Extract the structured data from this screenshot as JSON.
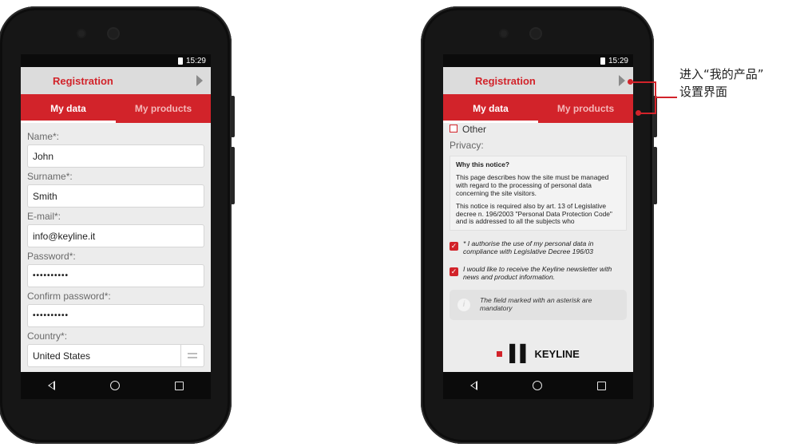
{
  "annotation": {
    "line1": "进入“我的产品”",
    "line2": "设置界面",
    "color": "#d2232a"
  },
  "theme": {
    "accent": "#d2232a",
    "appbar_bg": "#dcdcdc",
    "screen_bg": "#ececec"
  },
  "left_phone": {
    "status_time": "15:29",
    "header_title": "Registration",
    "tabs": [
      {
        "label": "My data",
        "active": true
      },
      {
        "label": "My products",
        "active": false
      }
    ],
    "fields": [
      {
        "label": "Name*:",
        "value": "John"
      },
      {
        "label": "Surname*:",
        "value": "Smith"
      },
      {
        "label": "E-mail*:",
        "value": "info@keyline.it"
      },
      {
        "label": "Password*:",
        "value": "••••••••••"
      },
      {
        "label": "Confirm password*:",
        "value": "••••••••••"
      },
      {
        "label": "Country*:",
        "value": "United States"
      }
    ]
  },
  "right_phone": {
    "status_time": "15:29",
    "header_title": "Registration",
    "tabs": [
      {
        "label": "My data",
        "active": true
      },
      {
        "label": "My products",
        "active": false
      }
    ],
    "other_option": "Other",
    "privacy_label": "Privacy:",
    "privacy_heading": "Why this notice?",
    "privacy_p1": "This page describes how the site must be managed with regard to the processing of personal data concerning the site visitors.",
    "privacy_p2": "This notice is required also by art. 13 of Legislative decree n. 196/2003 \"Personal Data Protection Code\" and is addressed to all the subjects who",
    "consent1": "* I authorise the use of my personal data in compliance with Legislative Decree 196/03",
    "consent2": "I would like to receive the Keyline newsletter with news and product information.",
    "note": "The field marked with an asterisk are mandatory",
    "logo_text": "KEYLINE"
  }
}
